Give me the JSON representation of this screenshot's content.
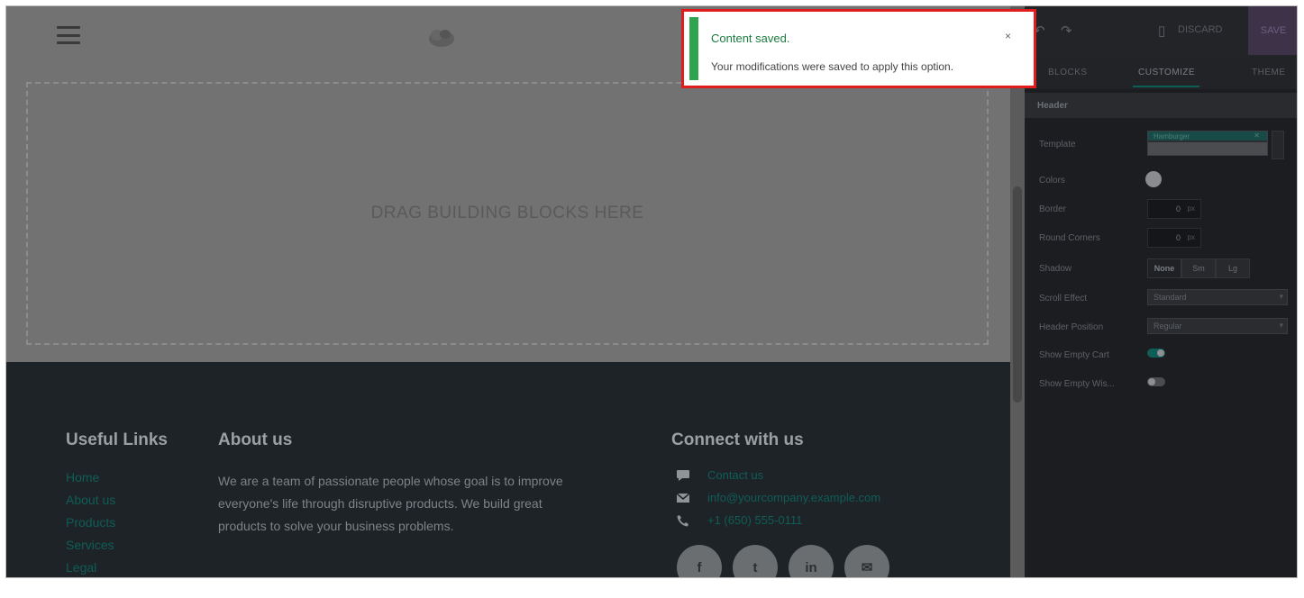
{
  "canvas": {
    "dropzone_text": "DRAG BUILDING BLOCKS HERE"
  },
  "footer": {
    "useful_links": {
      "title": "Useful Links",
      "items": [
        "Home",
        "About us",
        "Products",
        "Services",
        "Legal"
      ]
    },
    "about": {
      "title": "About us",
      "text": "We are a team of passionate people whose goal is to improve everyone's life through disruptive products. We build great products to solve your business problems."
    },
    "connect": {
      "title": "Connect with us",
      "items": [
        {
          "icon": "comment-icon",
          "text": "Contact us"
        },
        {
          "icon": "envelope-icon",
          "text": "info@yourcompany.example.com"
        },
        {
          "icon": "phone-icon",
          "text": "+1 (650) 555-0111"
        }
      ],
      "social": [
        "f",
        "t",
        "in",
        "✉"
      ]
    }
  },
  "sidebar": {
    "discard_label": "DISCARD",
    "save_label": "SAVE",
    "tabs": [
      "BLOCKS",
      "CUSTOMIZE",
      "THEME"
    ],
    "section_title": "Header",
    "options": {
      "template": {
        "label": "Template",
        "value": "Hamburger"
      },
      "colors": {
        "label": "Colors"
      },
      "border": {
        "label": "Border",
        "value": "0",
        "unit": "px"
      },
      "round_corners": {
        "label": "Round Corners",
        "value": "0",
        "unit": "px"
      },
      "shadow": {
        "label": "Shadow",
        "buttons": [
          "None",
          "Sm",
          "Lg"
        ]
      },
      "scroll_effect": {
        "label": "Scroll Effect",
        "value": "Standard"
      },
      "header_position": {
        "label": "Header Position",
        "value": "Regular"
      },
      "show_empty_cart": {
        "label": "Show Empty Cart",
        "on": true
      },
      "show_empty_wishlist": {
        "label": "Show Empty Wis...",
        "on": false
      }
    }
  },
  "toast": {
    "title": "Content saved.",
    "message": "Your modifications were saved to apply this option.",
    "close": "×"
  },
  "colors": {
    "accent": "#0f5d57",
    "toast_border": "#e11c1c",
    "toast_stripe": "#2ea44f"
  }
}
